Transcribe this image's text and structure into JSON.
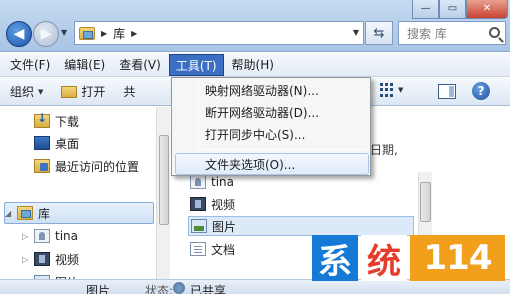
{
  "address": {
    "path": "库",
    "search_placeholder": "搜索 库"
  },
  "window_controls": {
    "minimize": "—",
    "maximize": "▭",
    "close": "✕"
  },
  "menubar": [
    {
      "label": "文件(F)"
    },
    {
      "label": "编辑(E)"
    },
    {
      "label": "查看(V)"
    },
    {
      "label": "工具(T)",
      "active": true
    },
    {
      "label": "帮助(H)"
    }
  ],
  "toolbar": {
    "organize": "组织",
    "open": "打开",
    "share_partial": "共",
    "help": "?"
  },
  "tools_menu": {
    "items": [
      "映射网络驱动器(N)...",
      "断开网络驱动器(D)...",
      "打开同步中心(S)...",
      "文件夹选项(O)..."
    ]
  },
  "nav_pane": {
    "favorites": [
      "下载",
      "桌面",
      "最近访问的位置"
    ],
    "library": "库",
    "library_children": [
      "tina",
      "视频",
      "图片"
    ]
  },
  "content": {
    "column_date": "日期,",
    "files": [
      "tina",
      "视频",
      "图片",
      "文档"
    ]
  },
  "statusbar": {
    "name": "图片",
    "state_label": "状态:",
    "shared": "已共享"
  },
  "watermark": {
    "c1": "系",
    "c2": "统",
    "c3": "114"
  }
}
